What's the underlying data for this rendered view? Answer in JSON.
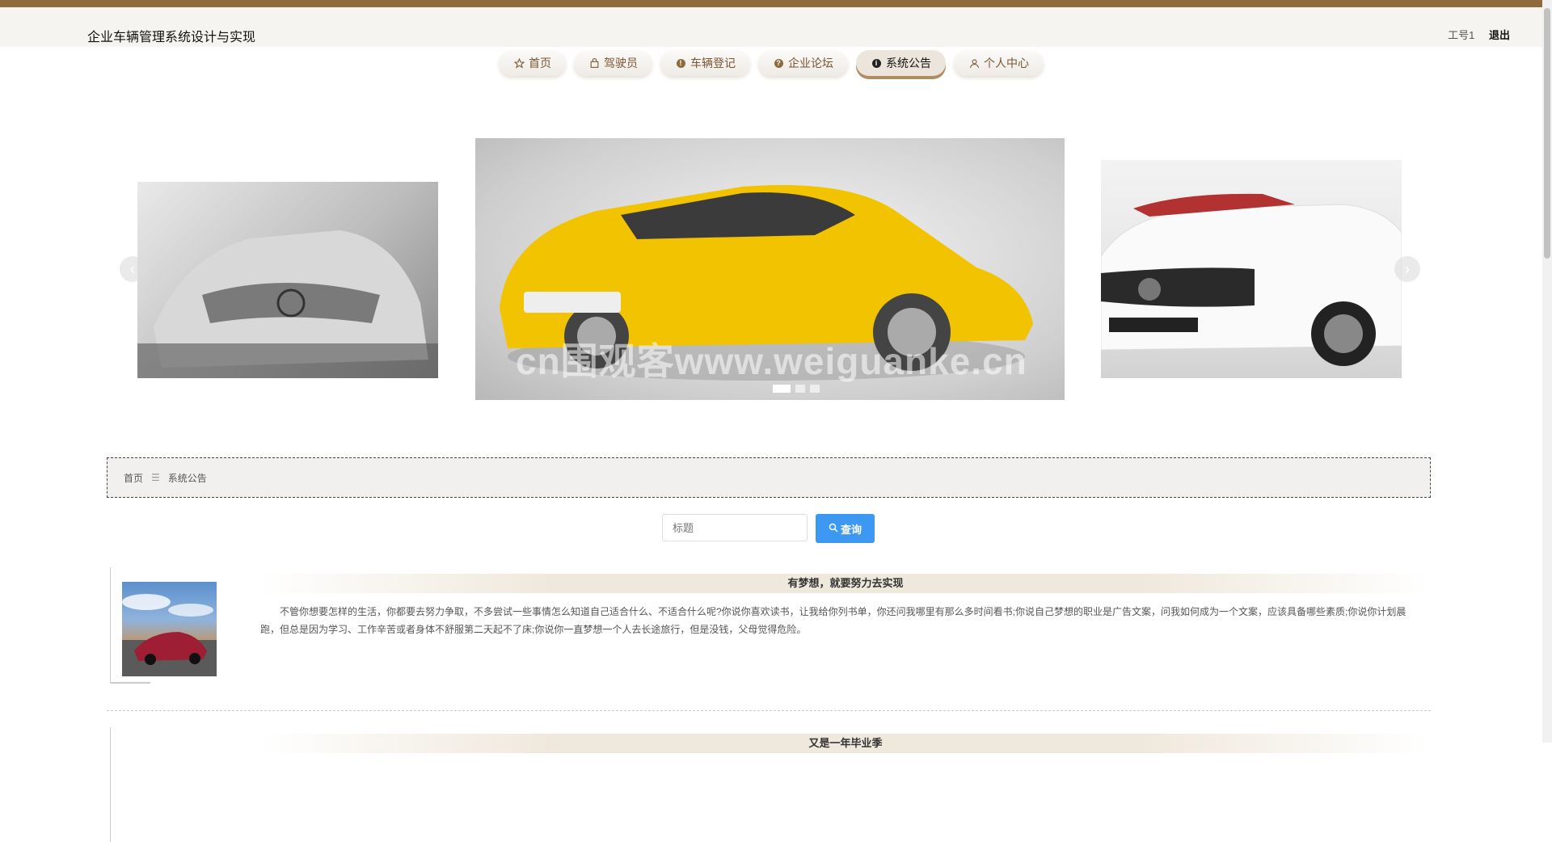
{
  "header": {
    "site_title": "企业车辆管理系统设计与实现",
    "user_label": "工号1",
    "logout_label": "退出"
  },
  "nav": {
    "items": [
      {
        "label": "首页",
        "icon": "star-icon"
      },
      {
        "label": "驾驶员",
        "icon": "bag-icon"
      },
      {
        "label": "车辆登记",
        "icon": "exclamation-icon"
      },
      {
        "label": "企业论坛",
        "icon": "question-icon"
      },
      {
        "label": "系统公告",
        "icon": "info-icon"
      },
      {
        "label": "个人中心",
        "icon": "user-icon"
      }
    ],
    "active": "系统公告"
  },
  "carousel": {
    "watermark": "cn围观客www.weiguanke.cn",
    "slide_count": 3,
    "current_slide": 1
  },
  "breadcrumb": {
    "home": "首页",
    "separator": "☰",
    "current": "系统公告"
  },
  "search": {
    "placeholder": "标题",
    "button_label": "查询"
  },
  "notices": [
    {
      "title": "有梦想，就要努力去实现",
      "body": "不管你想要怎样的生活，你都要去努力争取，不多尝试一些事情怎么知道自己适合什么、不适合什么呢?你说你喜欢读书，让我给你列书单，你还问我哪里有那么多时间看书;你说自己梦想的职业是广告文案，问我如何成为一个文案，应该具备哪些素质;你说你计划晨跑，但总是因为学习、工作辛苦或者身体不舒服第二天起不了床;你说你一直梦想一个人去长途旅行，但是没钱，父母觉得危险。"
    },
    {
      "title": "又是一年毕业季",
      "body": ""
    }
  ],
  "colors": {
    "accent_brown": "#8f6a3a",
    "search_button": "#3c98f0"
  }
}
